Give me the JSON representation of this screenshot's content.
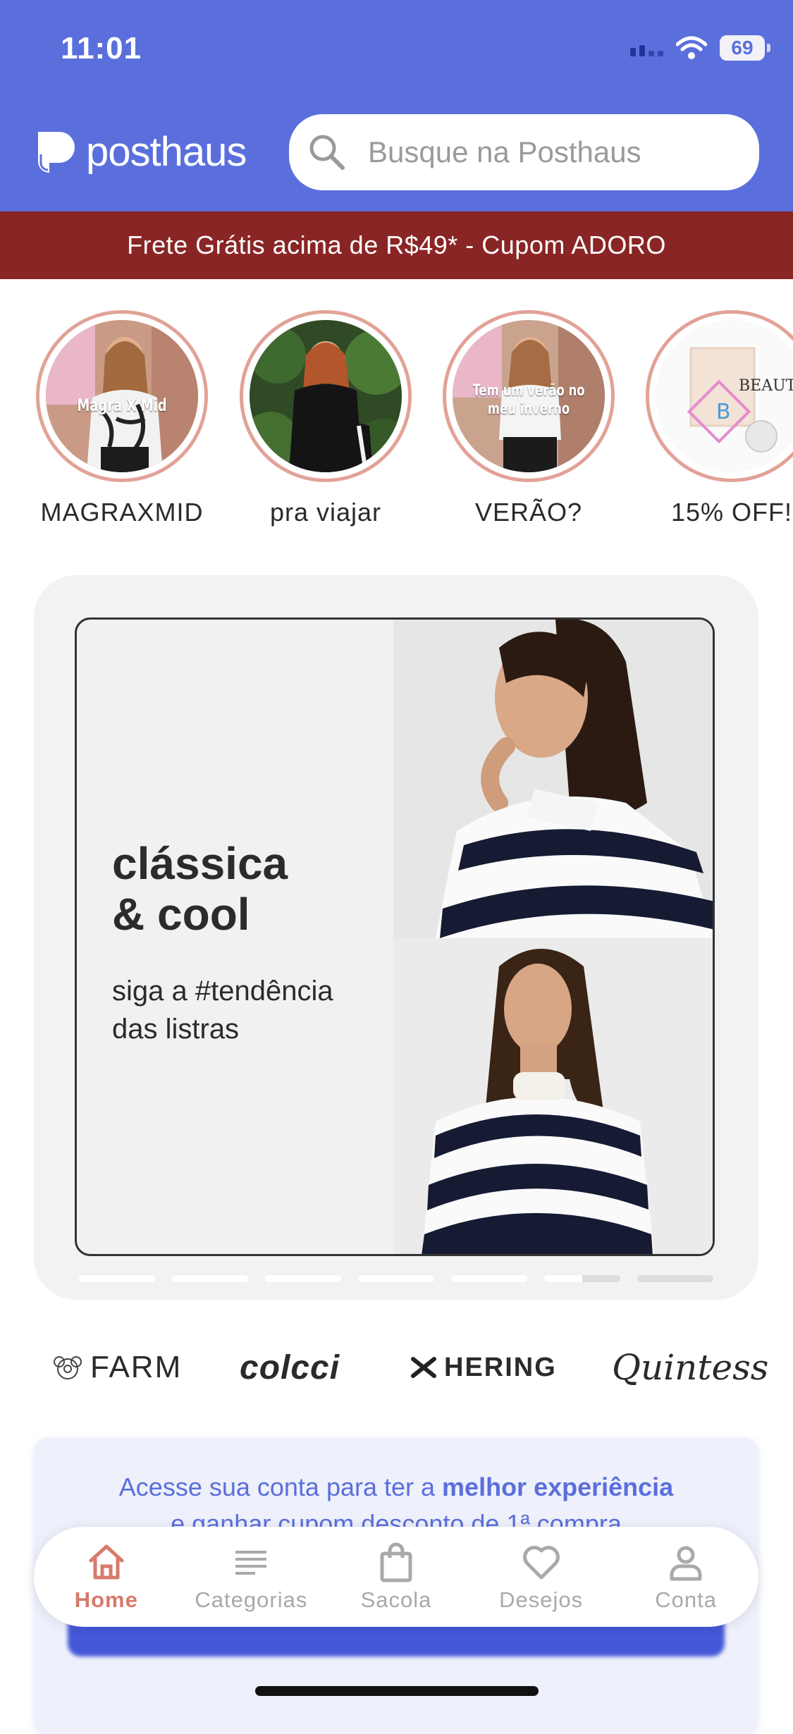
{
  "status_bar": {
    "time": "11:01",
    "battery": "69"
  },
  "header": {
    "logo_text": "posthaus",
    "search_placeholder": "Busque na Posthaus"
  },
  "promo_banner": "Frete Grátis acima de R$49* - Cupom ADORO",
  "stories": [
    {
      "label": "MAGRAXMID",
      "caption": "Magra X Mid"
    },
    {
      "label": "pra viajar",
      "caption": ""
    },
    {
      "label": "VERÃO?",
      "caption": "Tem um verão no meu inverno"
    },
    {
      "label": "15% OFF!",
      "caption": "BEAUTIQUE"
    }
  ],
  "banner": {
    "title_line1": "clássica",
    "title_line2": "& cool",
    "subtitle_line1": "siga a #tendência",
    "subtitle_line2": "das listras",
    "slide_count": 7,
    "active_slide": 6
  },
  "brands": [
    "FARM",
    "colcci",
    "HERING",
    "Quintess"
  ],
  "login_card": {
    "text_prefix": "Acesse sua conta para ter a ",
    "text_bold": "melhor experiência",
    "text_line2": "e ganhar cupom desconto de 1ª compra"
  },
  "tabbar": {
    "items": [
      {
        "label": "Home",
        "icon": "home-icon",
        "active": true
      },
      {
        "label": "Categorias",
        "icon": "list-icon",
        "active": false
      },
      {
        "label": "Sacola",
        "icon": "bag-icon",
        "active": false
      },
      {
        "label": "Desejos",
        "icon": "heart-icon",
        "active": false
      },
      {
        "label": "Conta",
        "icon": "person-icon",
        "active": false
      }
    ]
  },
  "colors": {
    "brand_blue": "#5a6fdc",
    "promo_red": "#8a2525",
    "accent_coral": "#d77a6a"
  }
}
